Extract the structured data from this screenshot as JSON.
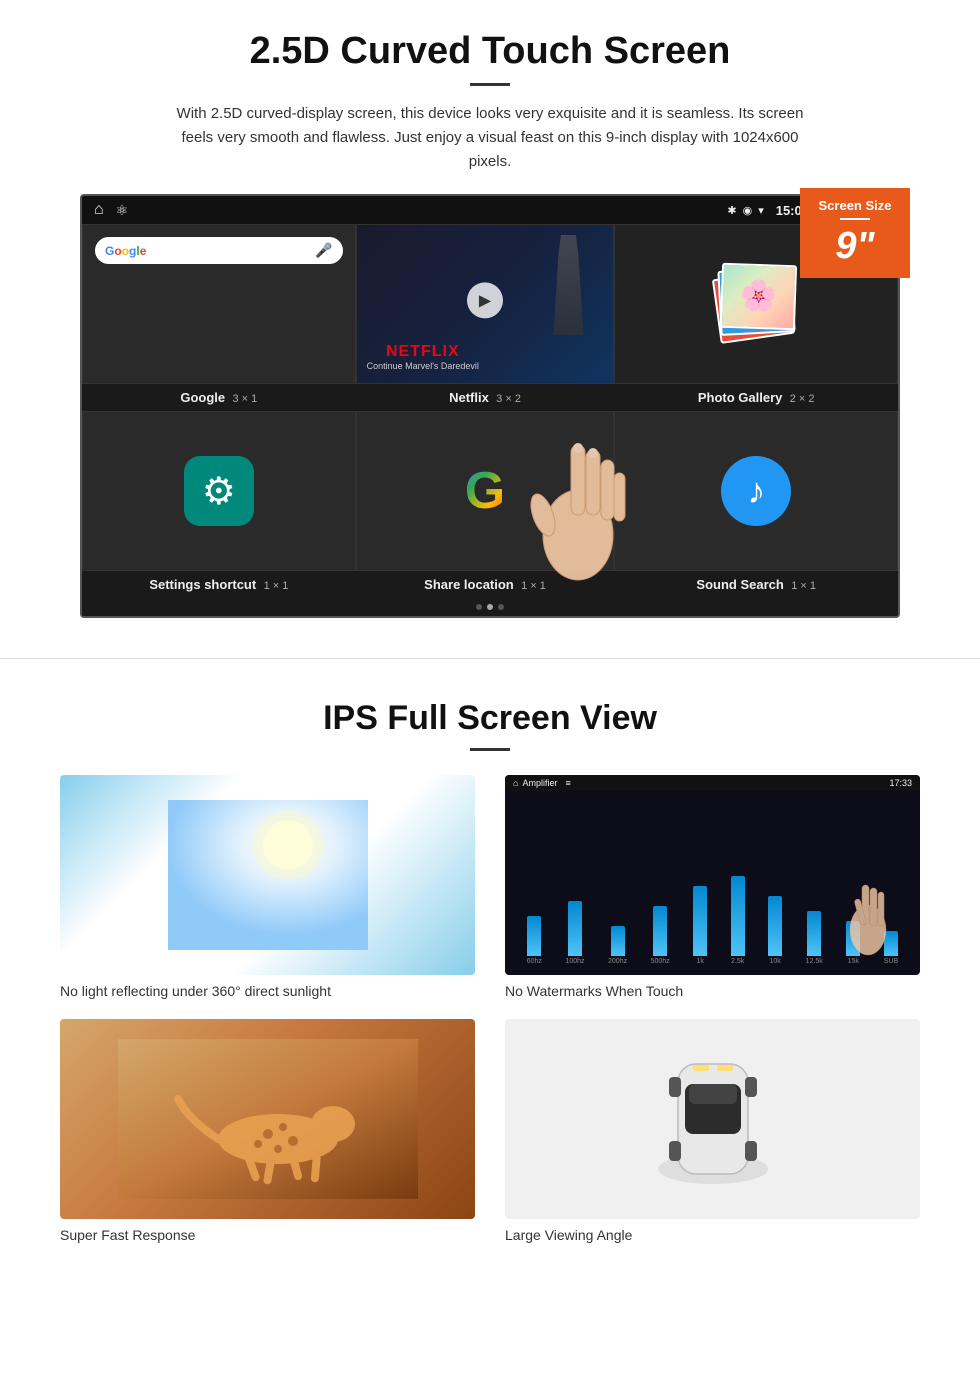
{
  "section1": {
    "title": "2.5D Curved Touch Screen",
    "description": "With 2.5D curved-display screen, this device looks very exquisite and it is seamless. Its screen feels very smooth and flawless. Just enjoy a visual feast on this 9-inch display with 1024x600 pixels.",
    "badge": {
      "title": "Screen Size",
      "size": "9\""
    },
    "statusBar": {
      "time": "15:06"
    },
    "apps": {
      "row1": [
        {
          "name": "Google",
          "size": "3 × 1"
        },
        {
          "name": "Netflix",
          "size": "3 × 2"
        },
        {
          "name": "Photo Gallery",
          "size": "2 × 2"
        }
      ],
      "row2": [
        {
          "name": "Settings shortcut",
          "size": "1 × 1"
        },
        {
          "name": "Share location",
          "size": "1 × 1"
        },
        {
          "name": "Sound Search",
          "size": "1 × 1"
        }
      ]
    },
    "netflix": {
      "brand": "NETFLIX",
      "subtitle": "Continue Marvel's Daredevil"
    }
  },
  "section2": {
    "title": "IPS Full Screen View",
    "items": [
      {
        "caption": "No light reflecting under 360° direct sunlight"
      },
      {
        "caption": "No Watermarks When Touch"
      },
      {
        "caption": "Super Fast Response"
      },
      {
        "caption": "Large Viewing Angle"
      }
    ]
  }
}
